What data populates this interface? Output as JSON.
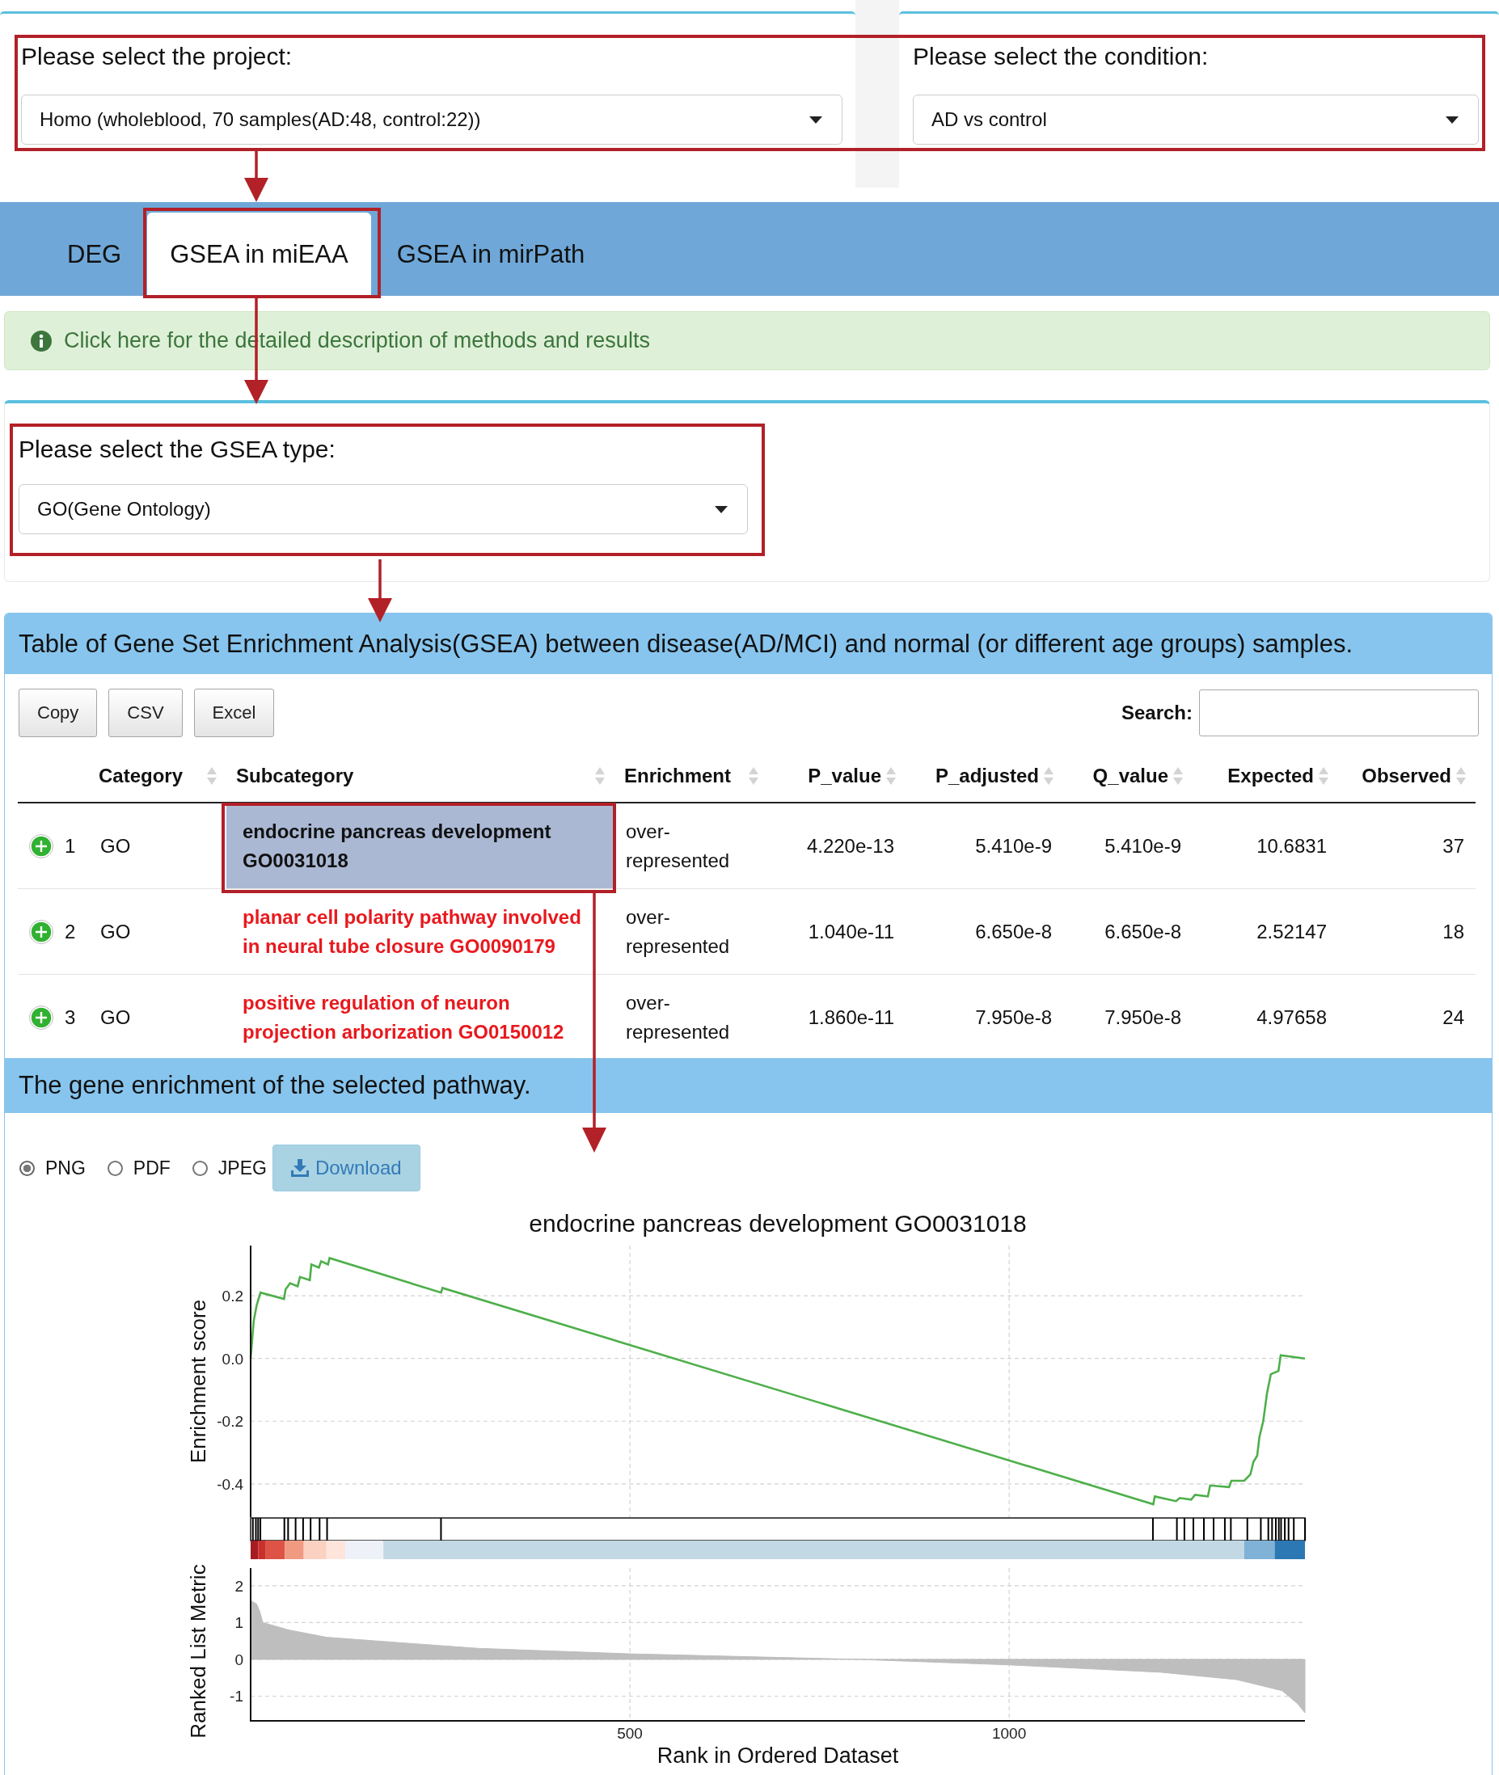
{
  "project": {
    "label": "Please select the project:",
    "value": "Homo (wholeblood, 70 samples(AD:48, control:22))"
  },
  "condition": {
    "label": "Please select the condition:",
    "value": "AD vs control"
  },
  "tabs": [
    {
      "label": "DEG",
      "selected": false
    },
    {
      "label": "GSEA in miEAA",
      "selected": true
    },
    {
      "label": "GSEA in mirPath",
      "selected": false
    }
  ],
  "info": {
    "text": "Click here for the detailed description of methods and results"
  },
  "gsea_type": {
    "label": "Please select the GSEA type:",
    "value": "GO(Gene Ontology)"
  },
  "table_panel": {
    "title": "Table of Gene Set Enrichment Analysis(GSEA) between disease(AD/MCI) and normal (or different age groups) samples.",
    "buttons": [
      "Copy",
      "CSV",
      "Excel"
    ],
    "search_label": "Search:",
    "columns": [
      "Category",
      "Subcategory",
      "Enrichment",
      "P_value",
      "P_adjusted",
      "Q_value",
      "Expected",
      "Observed"
    ],
    "rows": [
      {
        "index": "1",
        "category": "GO",
        "subcategory": "endocrine pancreas development GO0031018",
        "enrichment": "over-represented",
        "p_value": "4.220e-13",
        "p_adjusted": "5.410e-9",
        "q_value": "5.410e-9",
        "expected": "10.6831",
        "observed": "37",
        "selected": true
      },
      {
        "index": "2",
        "category": "GO",
        "subcategory": "planar cell polarity pathway involved in neural tube closure GO0090179",
        "enrichment": "over-represented",
        "p_value": "1.040e-11",
        "p_adjusted": "6.650e-8",
        "q_value": "6.650e-8",
        "expected": "2.52147",
        "observed": "18",
        "selected": false
      },
      {
        "index": "3",
        "category": "GO",
        "subcategory": "positive regulation of neuron projection arborization GO0150012",
        "enrichment": "over-represented",
        "p_value": "1.860e-11",
        "p_adjusted": "7.950e-8",
        "q_value": "7.950e-8",
        "expected": "4.97658",
        "observed": "24",
        "selected": false
      }
    ]
  },
  "pathway_panel": {
    "title": "The gene enrichment of the selected pathway.",
    "formats": [
      {
        "label": "PNG",
        "selected": true
      },
      {
        "label": "PDF",
        "selected": false
      },
      {
        "label": "JPEG",
        "selected": false
      }
    ],
    "download": "Download",
    "enrichment_plot": {
      "chart_data": {
        "type": "line",
        "title": "endocrine pancreas development GO0031018",
        "ylabel": "Enrichment score",
        "x": [
          0,
          4,
          8,
          13,
          44,
          46,
          52,
          62,
          65,
          78,
          80,
          90,
          93,
          102,
          104,
          251,
          253,
          1190,
          1192,
          1220,
          1225,
          1240,
          1245,
          1262,
          1265,
          1290,
          1293,
          1310,
          1318,
          1322,
          1327,
          1330,
          1335,
          1340,
          1345,
          1355,
          1358,
          1390
        ],
        "series": [
          {
            "color": "#4daf4a",
            "values": [
              0.0,
              0.12,
              0.17,
              0.21,
              0.19,
              0.22,
              0.24,
              0.23,
              0.26,
              0.25,
              0.3,
              0.29,
              0.31,
              0.3,
              0.32,
              0.21,
              0.225,
              -0.465,
              -0.44,
              -0.455,
              -0.445,
              -0.45,
              -0.435,
              -0.44,
              -0.405,
              -0.41,
              -0.39,
              -0.39,
              -0.37,
              -0.33,
              -0.31,
              -0.25,
              -0.2,
              -0.11,
              -0.05,
              -0.04,
              0.01,
              0.0
            ]
          }
        ],
        "xlim": [
          0,
          1390
        ],
        "ylim": [
          -0.506,
          0.36
        ],
        "yticks": [
          {
            "value": 0.2,
            "label": "0.2"
          },
          {
            "value": 0,
            "label": "0.0"
          },
          {
            "value": -0.2,
            "label": "-0.2"
          },
          {
            "value": -0.4,
            "label": "-0.4"
          }
        ],
        "grid": true
      }
    },
    "ranked_plot": {
      "chart_data": {
        "type": "area",
        "ylabel": "Ranked List Metric",
        "xlabel": "Rank in Ordered Dataset",
        "x": [
          0,
          8,
          12,
          16,
          50,
          100,
          200,
          300,
          500,
          800,
          1000,
          1200,
          1300,
          1360,
          1380,
          1390
        ],
        "series": [
          {
            "color": "#bebebe",
            "values": [
              1.6,
              1.5,
              1.3,
              1.0,
              0.8,
              0.6,
              0.45,
              0.3,
              0.15,
              0.0,
              -0.15,
              -0.35,
              -0.55,
              -0.85,
              -1.2,
              -1.45
            ]
          }
        ],
        "xlim": [
          0,
          1390
        ],
        "ylim": [
          -1.67,
          2.48
        ],
        "xticks": [
          500,
          1000
        ],
        "yticks": [
          2,
          1,
          0,
          -1
        ],
        "grid": true
      }
    }
  }
}
